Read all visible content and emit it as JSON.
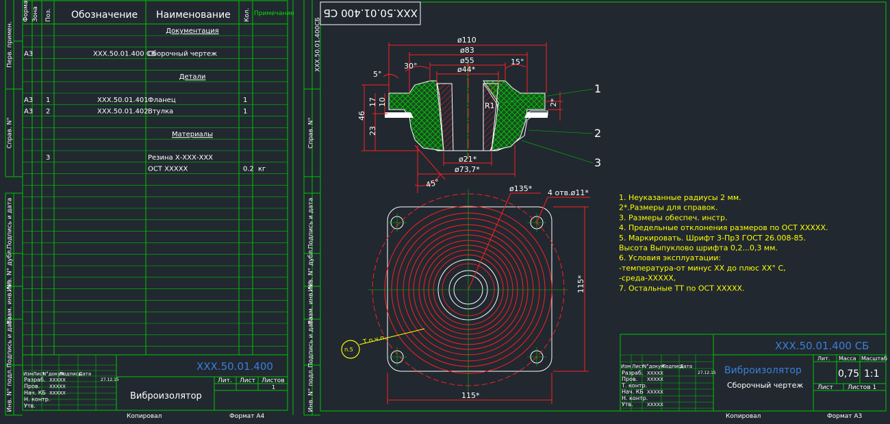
{
  "spec": {
    "headers": [
      "Формат",
      "Зона",
      "Поз.",
      "Обозначение",
      "Наименование",
      "Кол.",
      "Примечание"
    ],
    "rows": [
      {
        "fmt": "",
        "zone": "",
        "pos": "",
        "code": "",
        "name": "Документация",
        "qty": "",
        "note": "",
        "section": true
      },
      {
        "fmt": "",
        "zone": "",
        "pos": "",
        "code": "",
        "name": "",
        "qty": "",
        "note": ""
      },
      {
        "fmt": "А3",
        "zone": "",
        "pos": "",
        "code": "XXX.50.01.400 СБ",
        "name": "Сборочный чертеж",
        "qty": "",
        "note": ""
      },
      {
        "fmt": "",
        "zone": "",
        "pos": "",
        "code": "",
        "name": "",
        "qty": "",
        "note": ""
      },
      {
        "fmt": "",
        "zone": "",
        "pos": "",
        "code": "",
        "name": "Детали",
        "qty": "",
        "note": "",
        "section": true
      },
      {
        "fmt": "",
        "zone": "",
        "pos": "",
        "code": "",
        "name": "",
        "qty": "",
        "note": ""
      },
      {
        "fmt": "А3",
        "zone": "",
        "pos": "1",
        "code": "XXX.50.01.401",
        "name": "Фланец",
        "qty": "1",
        "note": ""
      },
      {
        "fmt": "А3",
        "zone": "",
        "pos": "2",
        "code": "XXX.50.01.402",
        "name": "Втулка",
        "qty": "1",
        "note": ""
      },
      {
        "fmt": "",
        "zone": "",
        "pos": "",
        "code": "",
        "name": "",
        "qty": "",
        "note": ""
      },
      {
        "fmt": "",
        "zone": "",
        "pos": "",
        "code": "",
        "name": "Материалы",
        "qty": "",
        "note": "",
        "section": true
      },
      {
        "fmt": "",
        "zone": "",
        "pos": "",
        "code": "",
        "name": "",
        "qty": "",
        "note": ""
      },
      {
        "fmt": "",
        "zone": "",
        "pos": "3",
        "code": "",
        "name": "Резина Х-ХХХ-ХХХ",
        "qty": "",
        "note": ""
      },
      {
        "fmt": "",
        "zone": "",
        "pos": "",
        "code": "",
        "name": "ОСТ XXXXX",
        "qty": "0.2",
        "note": "кг"
      }
    ],
    "title": {
      "code": "XXX.50.01.400",
      "name": "Виброизолятор",
      "lit": "Лит.",
      "sheet": "Лист",
      "sheets": "Листов",
      "sheets_value": "1"
    },
    "roles": [
      "Разраб.",
      "Пров.",
      "Нач. КБ",
      "Н. контр.",
      "Утв."
    ],
    "role_names": [
      "XXXXX",
      "XXXXX",
      "XXXXX",
      "",
      ""
    ],
    "cols": [
      "Изм",
      "Лист",
      "N°докум.",
      "Подпись",
      "Дата"
    ],
    "date": "27.12.15",
    "footer_copy": "Копировал",
    "footer_format": "Формат  А4"
  },
  "margins_left": [
    "Перв. примен.",
    "Справ. N°",
    "Подпись и дата",
    "Инв. N° дубл.",
    "Взам. инв. N°",
    "Подпись и дата",
    "Инв. N° подл."
  ],
  "margins_right": [
    "XXX.50.01.400СБ",
    "Справ. N°",
    "Подпись и дата",
    "Инв. N° дубл.",
    "Взам. инв. N°",
    "Подпись и дата",
    "Инв. N° подл."
  ],
  "drawing": {
    "code_box": "XXX.50.01.400 СБ",
    "dims_section": [
      "ø110",
      "ø83",
      "ø55",
      "ø44*",
      "30°",
      "15°",
      "5°",
      "2*",
      "46",
      "17",
      "10",
      "23",
      "R1",
      "ø21*",
      "ø73,7*",
      "45°"
    ],
    "dims_plan": [
      "ø135*",
      "4 отв.ø11*",
      "115*",
      "115*"
    ],
    "callouts": [
      "1",
      "2",
      "3"
    ],
    "mark": "п.5",
    "mark_label": "Т.п.ч.п.",
    "notes": [
      "1.  Неуказанные радиусы 2  мм.",
      "2*.Размеры для справок.",
      "3.  Размеры обеспеч. инстр.",
      "4.  Предельные отклонения размеров по ОСТ XXXXX.",
      "5.  Маркировать. Шрифт 3-Пр3  ГОСТ 26.008-85.",
      "  Высота Выпуклово шрифта 0,2...0,3 мм.",
      "6.  Условия эксплуатации:",
      "-температура-от минус XX до плюс XX° C,",
      "-среда-XXXXX,",
      "7.  Остальные ТТ по ОСТ XXXXX."
    ]
  },
  "stamp": {
    "code": "XXX.50.01.400 СБ",
    "name": "Виброизолятор",
    "subtitle": "Сборочный чертеж",
    "lit": "Лит.",
    "mass": "Масса",
    "scale": "Масштаб",
    "mass_value": "0,75",
    "scale_value": "1:1",
    "sheet": "Лист",
    "sheets": "Листов 1",
    "roles": [
      "Разраб.",
      "Пров.",
      "Т. контр.",
      "Нач. КБ",
      "Н. контр.",
      "Утв."
    ],
    "role_names": [
      "XXXXX",
      "XXXXX",
      "",
      "XXXXX",
      "",
      "XXXXX"
    ],
    "cols": [
      "Изм",
      "Лист",
      "N°докум.",
      "Подпись",
      "Дата"
    ],
    "date": "27.12.15",
    "footer_copy": "Копировал",
    "footer_format": "Формат  А3"
  }
}
